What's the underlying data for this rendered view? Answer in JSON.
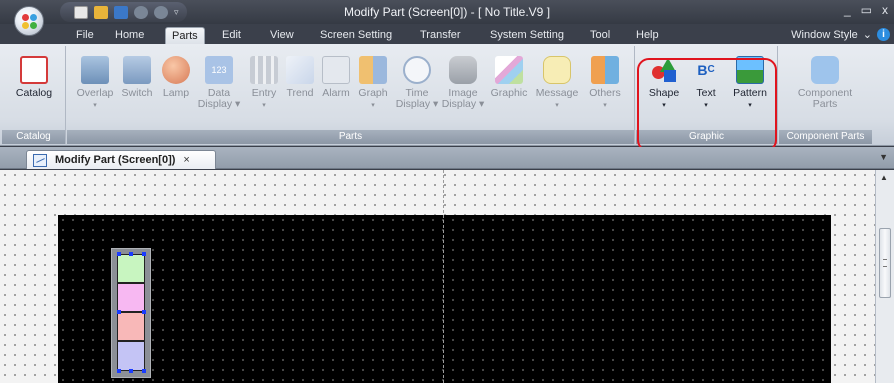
{
  "window": {
    "title": "Modify Part (Screen[0]) - [ No Title.V9 ]",
    "minimize": "_",
    "restore": "▭",
    "close": "x"
  },
  "menu_tabs": [
    {
      "label": "File"
    },
    {
      "label": "Home"
    },
    {
      "label": "Parts",
      "active": true
    },
    {
      "label": "Edit"
    },
    {
      "label": "View"
    },
    {
      "label": "Screen Setting"
    },
    {
      "label": "Transfer"
    },
    {
      "label": "System Setting"
    },
    {
      "label": "Tool"
    },
    {
      "label": "Help"
    }
  ],
  "window_style": "Window Style",
  "window_style_arrow": "⌄",
  "ribbon": {
    "groups": {
      "catalog": "Catalog",
      "parts": "Parts",
      "graphic": "Graphic",
      "component_parts": "Component Parts"
    },
    "buttons": {
      "catalog": "Catalog",
      "overlap": "Overlap",
      "switch": "Switch",
      "lamp": "Lamp",
      "data_display": [
        "Data",
        "Display ▾"
      ],
      "entry": "Entry",
      "trend": "Trend",
      "alarm": "Alarm",
      "graph": "Graph",
      "time_display": [
        "Time",
        "Display ▾"
      ],
      "image_display": [
        "Image",
        "Display ▾"
      ],
      "graphic": "Graphic",
      "message": "Message",
      "others": "Others",
      "shape": "Shape",
      "text": "Text",
      "pattern": "Pattern",
      "component_parts": [
        "Component",
        "Parts"
      ]
    },
    "dropdown_glyph": "▾"
  },
  "doc_tab": {
    "label": "Modify Part (Screen[0])",
    "close": "×",
    "overflow": "▼"
  },
  "scrollbar": {
    "up": "▲"
  },
  "colors": {
    "highlight": "#e0141e",
    "canvas": "#000000",
    "bar_segments": [
      "#c8f5c0",
      "#f7b8f2",
      "#f8b8b8",
      "#c4c4f5"
    ]
  }
}
